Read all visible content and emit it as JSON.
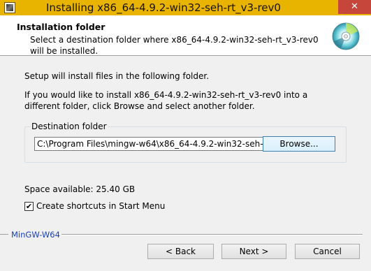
{
  "window": {
    "title": "Installing x86_64-4.9.2-win32-seh-rt_v3-rev0",
    "close_label": "✕"
  },
  "header": {
    "title": "Installation folder",
    "subtitle": "Select a destination folder where x86_64-4.9.2-win32-seh-rt_v3-rev0 will be installed."
  },
  "body": {
    "intro": "Setup will install files in the following folder.",
    "instructions": "If you would like to install x86_64-4.9.2-win32-seh-rt_v3-rev0 into a different folder, click Browse and select another folder.",
    "destination_group_label": "Destination folder",
    "destination_value": "C:\\Program Files\\mingw-w64\\x86_64-4.9.2-win32-seh-r",
    "browse_label": "Browse...",
    "space_available": "Space available: 25.40 GB",
    "shortcut_checked": true,
    "shortcut_label": "Create shortcuts in Start Menu"
  },
  "footer": {
    "branding": "MinGW-W64",
    "back_label": "< Back",
    "next_label": "Next >",
    "cancel_label": "Cancel"
  },
  "colors": {
    "titlebar": "#e8b400",
    "close_button": "#c7463c",
    "branding_text": "#1a3fb5"
  }
}
